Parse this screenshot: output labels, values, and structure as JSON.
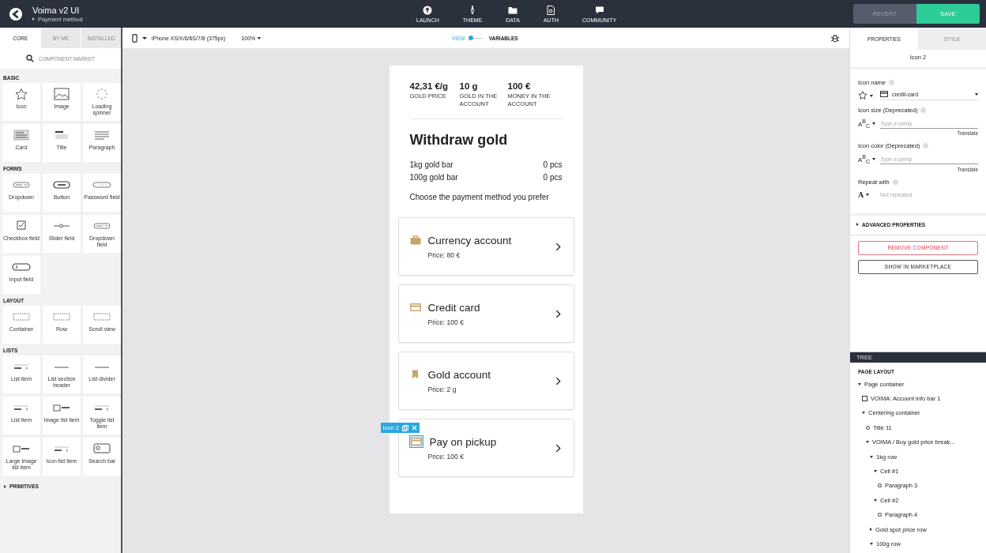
{
  "app": {
    "title": "Voima v2 UI",
    "screen": "Payment method"
  },
  "nav": [
    {
      "label": "LAUNCH",
      "kind": "launch"
    },
    {
      "label": "THEME",
      "kind": "theme"
    },
    {
      "label": "DATA",
      "kind": "data"
    },
    {
      "label": "AUTH",
      "kind": "auth"
    },
    {
      "label": "COMMUNITY",
      "kind": "community"
    }
  ],
  "actions": {
    "revert": "REVERT",
    "save": "SAVE"
  },
  "library": {
    "tabs": [
      {
        "label": "CORE",
        "selected": true
      },
      {
        "label": "BY ME",
        "selected": false
      },
      {
        "label": "INSTALLED",
        "selected": false
      }
    ],
    "market": "COMPONENT MARKET",
    "sections": [
      {
        "title": "BASIC",
        "items": [
          {
            "label": "Icon",
            "kind": "star"
          },
          {
            "label": "Image",
            "kind": "image"
          },
          {
            "label": "Loading spinner",
            "kind": "spinner"
          },
          {
            "label": "Card",
            "kind": "card"
          },
          {
            "label": "Title",
            "kind": "title"
          },
          {
            "label": "Paragraph",
            "kind": "paragraph"
          }
        ]
      },
      {
        "title": "FORMS",
        "items": [
          {
            "label": "Dropdown",
            "kind": "dropdown"
          },
          {
            "label": "Button",
            "kind": "button"
          },
          {
            "label": "Password field",
            "kind": "password"
          },
          {
            "label": "Checkbox field",
            "kind": "checkbox"
          },
          {
            "label": "Slider field",
            "kind": "slider"
          },
          {
            "label": "Dropdown field",
            "kind": "dropdown"
          },
          {
            "label": "Input field",
            "kind": "input"
          }
        ]
      },
      {
        "title": "LAYOUT",
        "items": [
          {
            "label": "Container",
            "kind": "dashed"
          },
          {
            "label": "Row",
            "kind": "dashed"
          },
          {
            "label": "Scroll view",
            "kind": "dashed"
          }
        ]
      },
      {
        "title": "LISTS",
        "items": [
          {
            "label": "List item",
            "kind": "listitem"
          },
          {
            "label": "List section header",
            "kind": "line"
          },
          {
            "label": "List divider",
            "kind": "line"
          },
          {
            "label": "List item",
            "kind": "listitem"
          },
          {
            "label": "Image list item",
            "kind": "imagelist"
          },
          {
            "label": "Toggle list item",
            "kind": "listitem"
          },
          {
            "label": "Large image list item",
            "kind": "imagelist"
          },
          {
            "label": "Icon list item",
            "kind": "listitem"
          },
          {
            "label": "Search bar",
            "kind": "search"
          }
        ]
      }
    ],
    "primitives": "PRIMITIVES"
  },
  "toolbar": {
    "device": "iPhone XS/X/6/6S/7/8 (375px)",
    "zoom": "100%",
    "modes": [
      {
        "label": "VIEW",
        "selected": true
      },
      {
        "label": "VARIABLES",
        "selected": false
      }
    ]
  },
  "phone": {
    "stats": [
      {
        "value": "42,31 €/g",
        "label": "GOLD PRICE"
      },
      {
        "value": "10 g",
        "label": "GOLD IN THE ACCOUNT"
      },
      {
        "value": "100 €",
        "label": "MONEY IN THE ACCOUNT"
      }
    ],
    "heading": "Withdraw gold",
    "rows": [
      {
        "name": "1kg gold bar",
        "amount": "0 pcs"
      },
      {
        "name": "100g gold bar",
        "amount": "0 pcs"
      }
    ],
    "prompt": "Choose the payment method you prefer",
    "methods": [
      {
        "title": "Currency account",
        "price": "Price: 80 €",
        "kind": "briefcase",
        "color": "#c9a46a",
        "selected": false
      },
      {
        "title": "Credit card",
        "price": "Price: 100 €",
        "kind": "card",
        "color": "#c9a46a",
        "selected": false
      },
      {
        "title": "Gold account",
        "price": "Price: 2 g",
        "kind": "bookmark",
        "color": "#c9a46a",
        "selected": false
      },
      {
        "title": "Pay on pickup",
        "price": "Price: 100 €",
        "kind": "card",
        "color": "#c9a46a",
        "selected": true
      }
    ],
    "selection_label": "Icon 2"
  },
  "inspector": {
    "tabs": [
      {
        "label": "PROPERTIES",
        "selected": true
      },
      {
        "label": "STYLE",
        "selected": false
      }
    ],
    "component": "Icon 2",
    "icon_name": {
      "label": "Icon name",
      "value": "credit-card"
    },
    "fields": [
      {
        "label": "Icon size (Deprecated)",
        "type": "A$^{B}$$_{C}$",
        "placeholder": "Type a string",
        "link": "Translate"
      },
      {
        "label": "Icon color (Deprecated)",
        "type": "A$^{B}$$_{C}$",
        "placeholder": "Type a string",
        "link": "Translate"
      }
    ],
    "repeat": {
      "label": "Repeat with",
      "type": "A",
      "value": "Not repeated"
    },
    "advanced": "ADVANCED PROPERTIES",
    "remove": "REMOVE COMPONENT",
    "marketplace": "SHOW IN MARKETPLACE"
  },
  "tree": {
    "title": "TREE",
    "root": "PAGE LAYOUT",
    "items": [
      {
        "label": "Page container",
        "kind": "group",
        "expanded": true,
        "children": [
          {
            "label": "VOIMA: Account info bar 1",
            "kind": "component"
          },
          {
            "label": "Centering container",
            "kind": "group",
            "expanded": true,
            "children": [
              {
                "label": "Title 11",
                "kind": "leaf"
              },
              {
                "label": "VOIMA / Buy gold price break...",
                "kind": "group",
                "expanded": true,
                "children": [
                  {
                    "label": "1kg row",
                    "kind": "group",
                    "expanded": true,
                    "children": [
                      {
                        "label": "Cell #1",
                        "kind": "group",
                        "expanded": true,
                        "children": [
                          {
                            "label": "Paragraph 3",
                            "kind": "leaf"
                          }
                        ]
                      },
                      {
                        "label": "Cell #2",
                        "kind": "group",
                        "expanded": true,
                        "children": [
                          {
                            "label": "Paragraph 4",
                            "kind": "leaf"
                          }
                        ]
                      }
                    ]
                  },
                  {
                    "label": "Gold spot price row",
                    "kind": "group",
                    "expanded": false
                  },
                  {
                    "label": "100g row",
                    "kind": "group",
                    "expanded": true
                  }
                ]
              }
            ]
          }
        ]
      }
    ]
  }
}
